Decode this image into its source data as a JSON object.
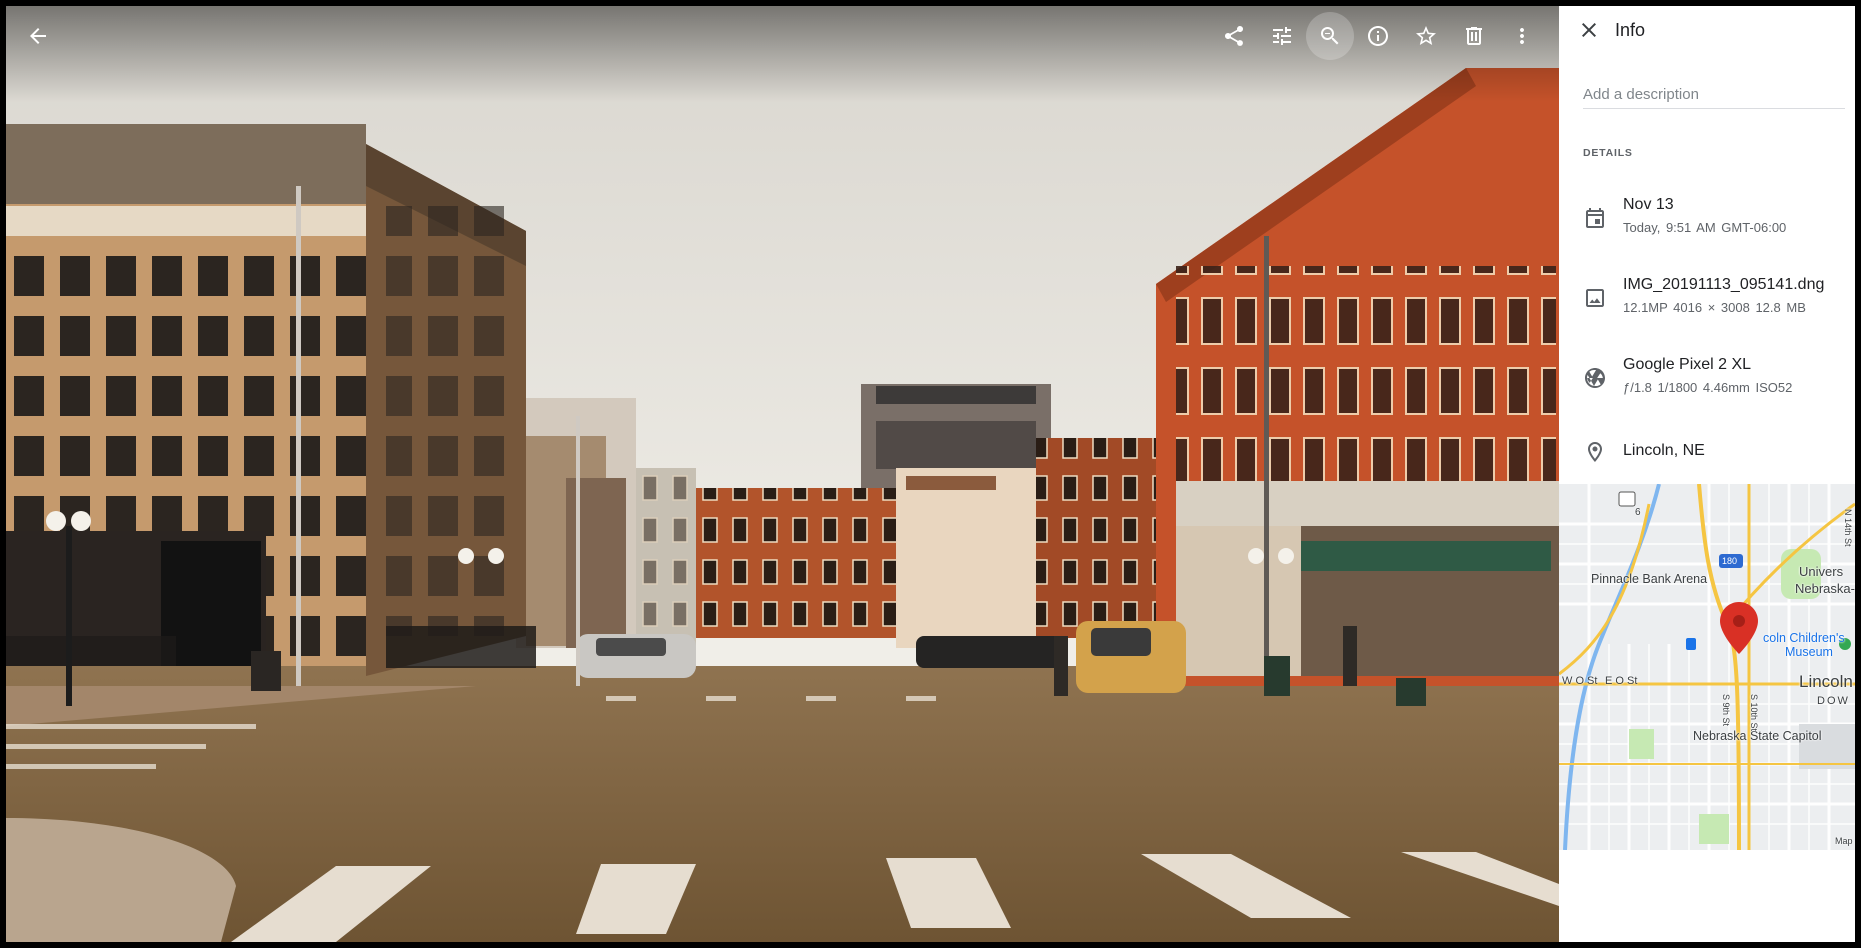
{
  "toolbar": {
    "back_icon": "arrow-back-icon",
    "actions": [
      "share-icon",
      "edit-tune-icon",
      "zoom-out-icon",
      "info-icon",
      "star-icon",
      "delete-icon",
      "more-vert-icon"
    ]
  },
  "panel": {
    "title": "Info",
    "description_placeholder": "Add a description",
    "details_label": "DETAILS",
    "date": {
      "title": "Nov 13",
      "subtitle": "Today, 9:51 AM   GMT-06:00"
    },
    "file": {
      "title": "IMG_20191113_095141.dng",
      "subtitle": "12.1MP   4016 × 3008   12.8 MB"
    },
    "camera": {
      "title": "Google Pixel 2 XL",
      "subtitle": "ƒ/1.8   1/1800   4.46mm   ISO52"
    },
    "location": {
      "title": "Lincoln, NE"
    }
  },
  "map": {
    "labels": {
      "pinnacle": "Pinnacle Bank Arena",
      "university": "Univers",
      "nebraska": "Nebraska-",
      "childrens1": "coln Children's",
      "childrens2": "Museum",
      "wost": "W O St",
      "eost": "E O St",
      "lincoln": "Lincoln",
      "downtown": "DOW",
      "capitol": "Nebraska State Capitol",
      "n14": "N 14th St",
      "s9": "S 9th St",
      "s10": "S 10th St",
      "hwy6": "6",
      "i180": "180",
      "attribution": "Map"
    },
    "colors": {
      "highway": "#f5c542",
      "water": "#7fb6ef",
      "park": "#c6e9b3",
      "pin": "#d93025"
    }
  },
  "colors": {
    "panel_bg": "#ffffff",
    "accent": "#1a73e8"
  }
}
